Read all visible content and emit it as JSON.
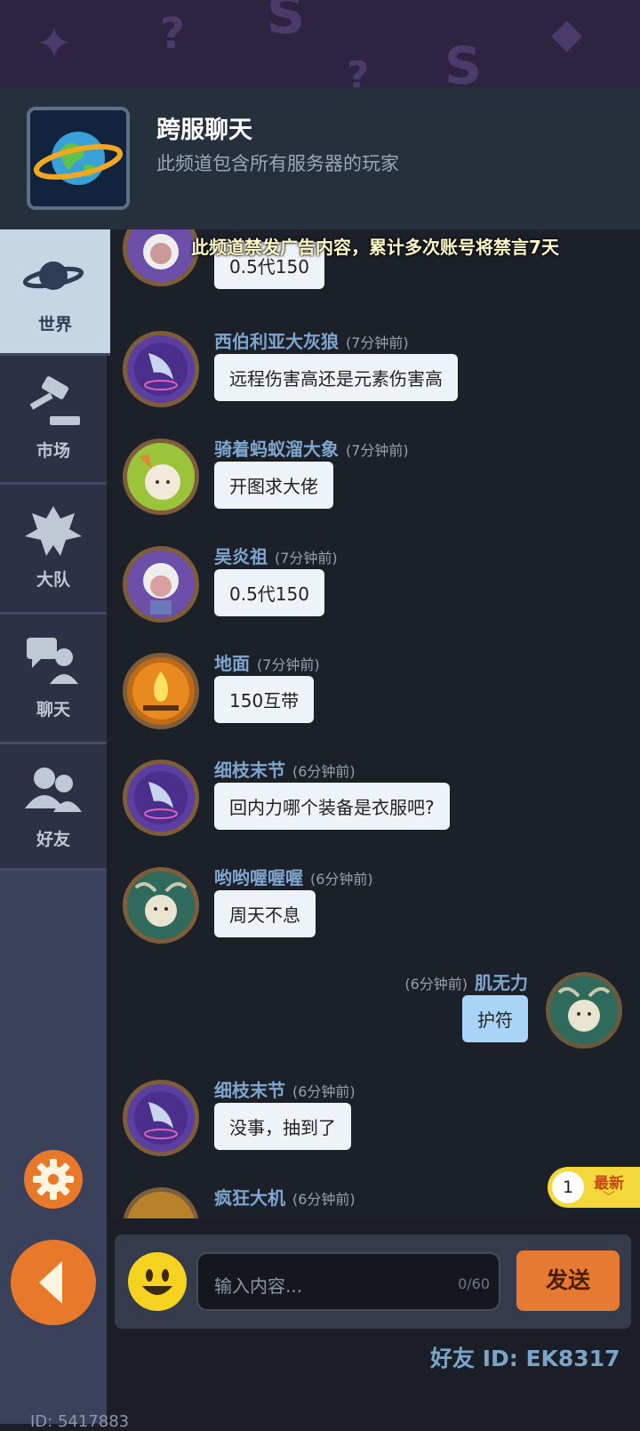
{
  "header": {
    "title": "跨服聊天",
    "subtitle": "此频道包含所有服务器的玩家",
    "notice": "此频道禁发广告内容，累计多次账号将禁言7天"
  },
  "sidebar": {
    "items": [
      {
        "label": "世界",
        "icon": "planet-icon"
      },
      {
        "label": "市场",
        "icon": "gavel-icon"
      },
      {
        "label": "大队",
        "icon": "guild-emblem-icon"
      },
      {
        "label": "聊天",
        "icon": "chat-bubbles-icon"
      },
      {
        "label": "好友",
        "icon": "friends-icon"
      }
    ]
  },
  "messages": [
    {
      "name": "",
      "time": "",
      "text": "0.5代150"
    },
    {
      "name": "西伯利亚大灰狼",
      "time": "(7分钟前)",
      "text": "远程伤害高还是元素伤害高"
    },
    {
      "name": "骑着蚂蚁溜大象",
      "time": "(7分钟前)",
      "text": "开图求大佬"
    },
    {
      "name": "吴炎祖",
      "time": "(7分钟前)",
      "text": "0.5代150"
    },
    {
      "name": "地面",
      "time": "(7分钟前)",
      "text": "150互带"
    },
    {
      "name": "细枝末节",
      "time": "(6分钟前)",
      "text": "回内力哪个装备是衣服吧?"
    },
    {
      "name": "哟哟喔喔喔",
      "time": "(6分钟前)",
      "text": "周天不息"
    },
    {
      "name": "肌无力",
      "time": "(6分钟前)",
      "text": "护符"
    },
    {
      "name": "细枝末节",
      "time": "(6分钟前)",
      "text": "没事，抽到了"
    },
    {
      "name": "疯狂大机",
      "time": "(6分钟前)",
      "text": ""
    }
  ],
  "newest": {
    "count": "1",
    "label": "最新"
  },
  "input": {
    "placeholder": "输入内容...",
    "counter": "0/60",
    "send_label": "发送"
  },
  "footer": {
    "friend_id": "好友 ID: EK8317",
    "player_id": "ID: 5417883"
  },
  "colors": {
    "accent_orange": "#e67a33",
    "name_blue": "#7ea6cf",
    "self_bubble": "#a9d3f7",
    "badge_yellow": "#f4d83b"
  }
}
